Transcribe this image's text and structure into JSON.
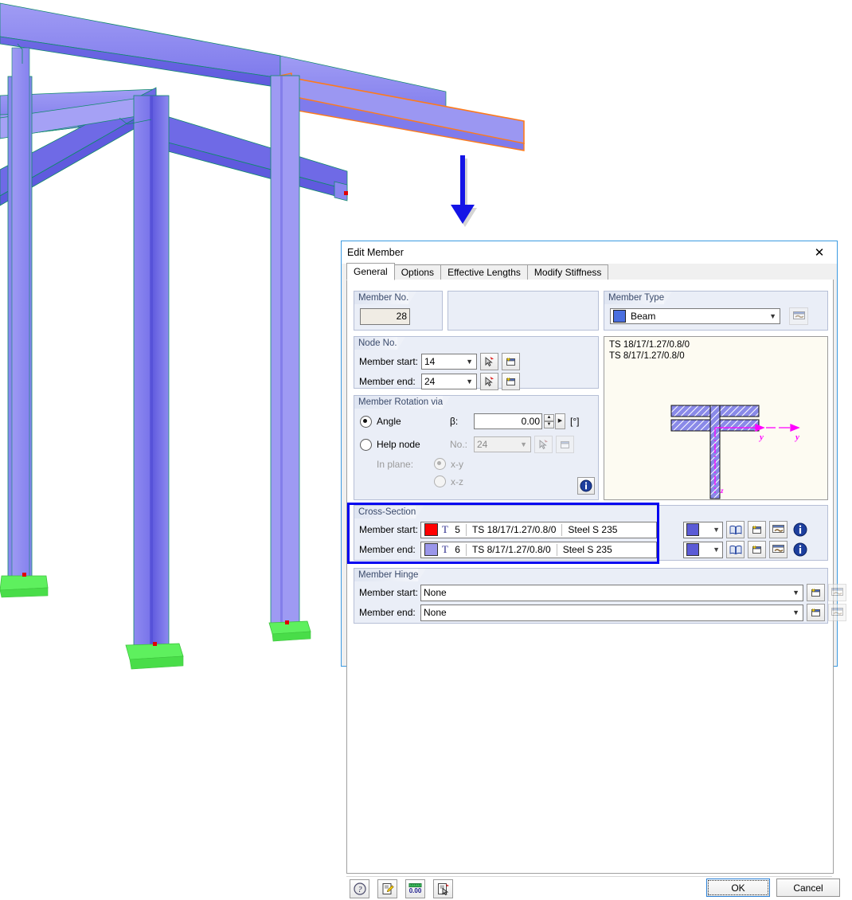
{
  "scene": {
    "name": "3d-structure-view",
    "description": "Steel frame structure, isometric view",
    "member_color": "#6f6be8",
    "member_color_light": "#9b97f2",
    "support_color": "#5ef05e",
    "selected_member_outline": "#ff7a1a",
    "node_marker_color": "#e00000",
    "edge_color": "#0e8a6a"
  },
  "callout": {
    "arrow_color": "#1414e6",
    "name": "callout-arrow-down"
  },
  "dialog": {
    "title": "Edit Member",
    "close_label": "✕",
    "tabs": [
      {
        "label": "General",
        "active": true
      },
      {
        "label": "Options",
        "active": false
      },
      {
        "label": "Effective Lengths",
        "active": false
      },
      {
        "label": "Modify Stiffness",
        "active": false
      }
    ],
    "member_no": {
      "header": "Member No.",
      "value": "28"
    },
    "member_type": {
      "header": "Member Type",
      "value": "Beam",
      "swatch_color": "#4a6fe0",
      "edit_icon": "properties-icon"
    },
    "node_no": {
      "header": "Node No.",
      "start_label": "Member start:",
      "start_value": "14",
      "end_label": "Member end:",
      "end_value": "24",
      "pick_icon": "pick-node-icon",
      "new_icon": "new-node-icon"
    },
    "member_rotation": {
      "header": "Member Rotation via",
      "angle_label": "Angle",
      "beta_label": "β:",
      "beta_value": "0.00",
      "beta_unit": "[°]",
      "angle_selected": true,
      "help_node_label": "Help node",
      "help_node_no_label": "No.:",
      "help_node_value": "24",
      "in_plane_label": "In plane:",
      "plane_xy": "x-y",
      "plane_xz": "x-z",
      "plane_xy_selected": true,
      "info_icon": "info-icon"
    },
    "preview": {
      "line1": "TS 18/17/1.27/0.8/0",
      "line2": "TS 8/17/1.27/0.8/0",
      "axis_label_y1": "y",
      "axis_label_y2": "y",
      "axis_label_z": "z",
      "axis_color": "#ff00ff",
      "section_fill": "#8a8ae8",
      "background": "#fdfbf2"
    },
    "cross_section": {
      "header": "Cross-Section",
      "highlight_color": "#0000f0",
      "rows": [
        {
          "label": "Member start:",
          "swatch_color": "#ff0000",
          "type_glyph": "T",
          "no": "5",
          "designation": "TS 18/17/1.27/0.8/0",
          "material": "Steel S 235",
          "color_combo_swatch": "#5b5bd6"
        },
        {
          "label": "Member end:",
          "swatch_color": "#9a96ea",
          "type_glyph": "T",
          "no": "6",
          "designation": "TS 8/17/1.27/0.8/0",
          "material": "Steel S 235",
          "color_combo_swatch": "#5b5bd6"
        }
      ],
      "buttons": [
        "library-icon",
        "new-section-icon",
        "properties-icon",
        "info-icon"
      ]
    },
    "member_hinge": {
      "header": "Member Hinge",
      "start_label": "Member start:",
      "start_value": "None",
      "end_label": "Member end:",
      "end_value": "None",
      "new_icon": "new-hinge-icon",
      "edit_icon": "properties-icon"
    },
    "footer": {
      "tool_icons": [
        "help-icon",
        "comment-icon",
        "units-icon",
        "select-icon"
      ],
      "ok_label": "OK",
      "cancel_label": "Cancel"
    }
  }
}
